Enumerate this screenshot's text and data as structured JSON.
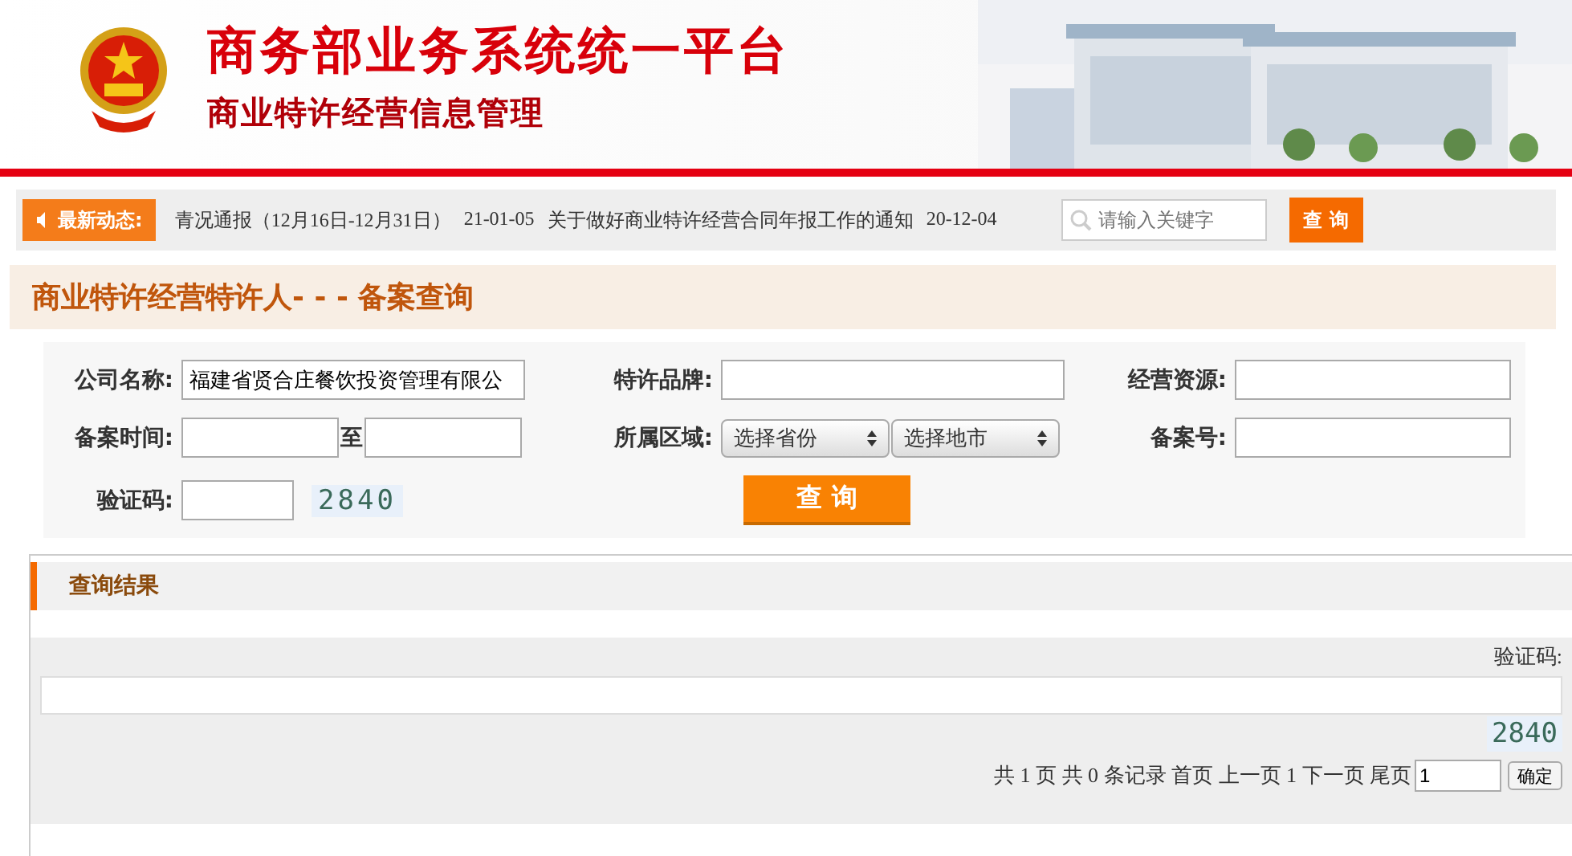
{
  "header": {
    "title": "商务部业务系统统一平台",
    "subtitle": "商业特许经营信息管理"
  },
  "news": {
    "label": "最新动态:",
    "items": [
      {
        "title": "青况通报（12月16日-12月31日）",
        "date": "21-01-05"
      },
      {
        "title": "关于做好商业特许经营合同年报工作的通知",
        "date": "20-12-04"
      }
    ],
    "search": {
      "placeholder": "请输入关键字"
    },
    "search_button": "查 询"
  },
  "page_title": "商业特许经营特许人- - - 备案查询",
  "form": {
    "company_label": "公司名称:",
    "company_value": "福建省贤合庄餐饮投资管理有限公",
    "brand_label": "特许品牌:",
    "resource_label": "经营资源:",
    "date_label": "备案时间:",
    "date_sep": "至",
    "region_label": "所属区域:",
    "province": "选择省份",
    "city": "选择地市",
    "record_label": "备案号:",
    "captcha_label": "验证码:",
    "captcha": "2840",
    "submit": "查 询"
  },
  "results": {
    "title": "查询结果",
    "captcha_label": "验证码:",
    "captcha": "2840",
    "pager": "共 1 页 共 0 条记录 首页 上一页 1 下一页 尾页",
    "page_value": "1",
    "confirm": "确定"
  }
}
